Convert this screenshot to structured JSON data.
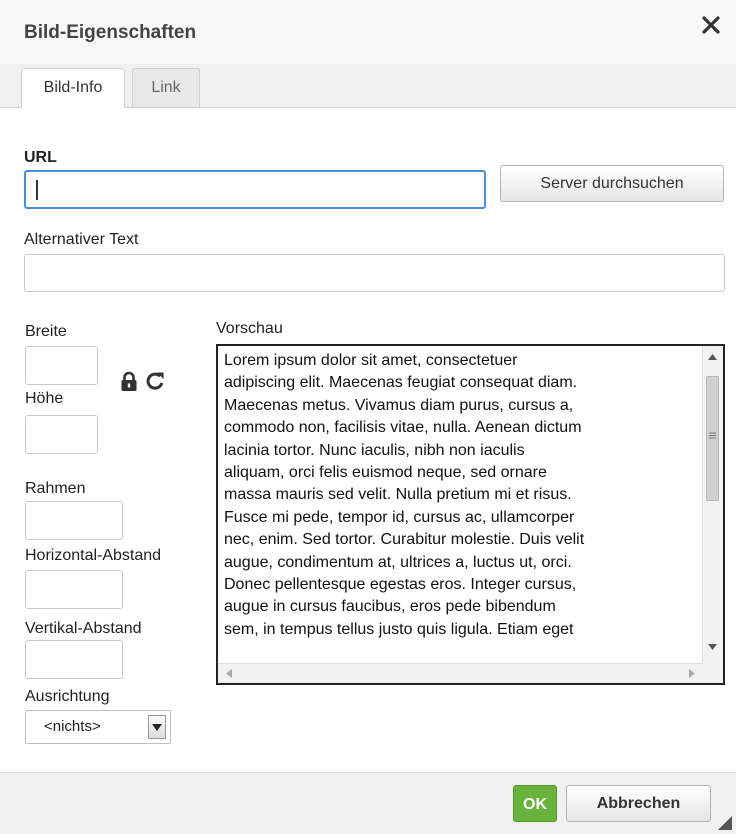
{
  "dialog": {
    "title": "Bild-Eigenschaften"
  },
  "tabs": [
    {
      "label": "Bild-Info",
      "active": true
    },
    {
      "label": "Link",
      "active": false
    }
  ],
  "form": {
    "url_label": "URL",
    "url_value": "",
    "browse_button": "Server durchsuchen",
    "alt_label": "Alternativer Text",
    "alt_value": "",
    "width_label": "Breite",
    "height_label": "Höhe",
    "border_label": "Rahmen",
    "hspace_label": "Horizontal-Abstand",
    "vspace_label": "Vertikal-Abstand",
    "align_label": "Ausrichtung",
    "align_value": "<nichts>"
  },
  "preview": {
    "label": "Vorschau",
    "lines": [
      "Lorem ipsum dolor sit amet, consectetuer",
      "adipiscing elit. Maecenas feugiat consequat diam.",
      "Maecenas metus. Vivamus diam purus, cursus a,",
      "commodo non, facilisis vitae, nulla. Aenean dictum",
      "lacinia tortor. Nunc iaculis, nibh non iaculis",
      "aliquam, orci felis euismod neque, sed ornare",
      "massa mauris sed velit. Nulla pretium mi et risus.",
      "Fusce mi pede, tempor id, cursus ac, ullamcorper",
      "nec, enim. Sed tortor. Curabitur molestie. Duis velit",
      "augue, condimentum at, ultrices a, luctus ut, orci.",
      "Donec pellentesque egestas eros. Integer cursus,",
      "augue in cursus faucibus, eros pede bibendum",
      "sem, in tempus tellus justo quis ligula. Etiam eget"
    ]
  },
  "footer": {
    "ok_label": "OK",
    "cancel_label": "Abbrechen"
  },
  "colors": {
    "accent": "#4a90d9",
    "ok_button": "#69b33c"
  },
  "icons": {
    "close": "close-icon",
    "lock": "lock-icon",
    "reset": "reset-icon",
    "dropdown": "chevron-down-icon"
  }
}
